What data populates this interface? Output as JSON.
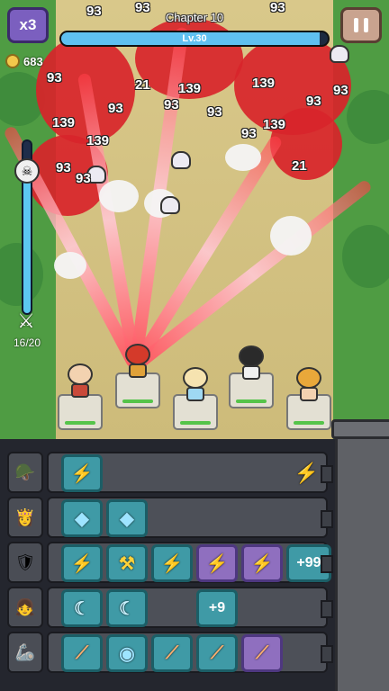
{
  "hud": {
    "speed_label": "x3",
    "chapter_label": "Chapter 10",
    "level_label": "Lv.30",
    "level_progress": 0.97,
    "coins": "683",
    "wave_text": "16/20",
    "wave_progress": 0.8
  },
  "damage_numbers": [
    "93",
    "93",
    "93",
    "139",
    "93",
    "139",
    "93",
    "21",
    "93",
    "139",
    "93",
    "93",
    "139",
    "93",
    "93",
    "21",
    "93",
    "139",
    "93",
    "93"
  ],
  "heroes": [
    {
      "name": "viking"
    },
    {
      "name": "iron-knight"
    },
    {
      "name": "ice-princess"
    },
    {
      "name": "dark-hair-girl"
    },
    {
      "name": "wizard"
    }
  ],
  "inventory": {
    "rows": [
      {
        "hero": "viking",
        "slots": [
          {
            "icon": "bolt-coin"
          }
        ],
        "lane_icon": "bolt"
      },
      {
        "hero": "ice-princess",
        "slots": [
          {
            "icon": "crystal"
          },
          {
            "icon": "crystal"
          }
        ]
      },
      {
        "hero": "viking-2",
        "slots": [
          {
            "icon": "bolt"
          },
          {
            "icon": "hammer-bolt"
          },
          {
            "icon": "bolt"
          },
          {
            "icon": "bolt",
            "style": "purple"
          },
          {
            "icon": "bolt",
            "style": "purple"
          },
          {
            "count": "+99"
          }
        ]
      },
      {
        "hero": "dark-hair-girl",
        "slots": [
          {
            "icon": "sickle"
          },
          {
            "icon": "sickle"
          },
          {
            "empty": true
          },
          {
            "count": "+9"
          }
        ]
      },
      {
        "hero": "iron-knight",
        "slots": [
          {
            "icon": "bat"
          },
          {
            "icon": "bat-orb"
          },
          {
            "icon": "bat"
          },
          {
            "icon": "bat"
          },
          {
            "icon": "bat",
            "style": "purple"
          }
        ]
      }
    ]
  },
  "colors": {
    "accent_purple": "#7b5fbf",
    "beam_red": "#ff3b46",
    "slot_teal": "#3f9aa6"
  }
}
